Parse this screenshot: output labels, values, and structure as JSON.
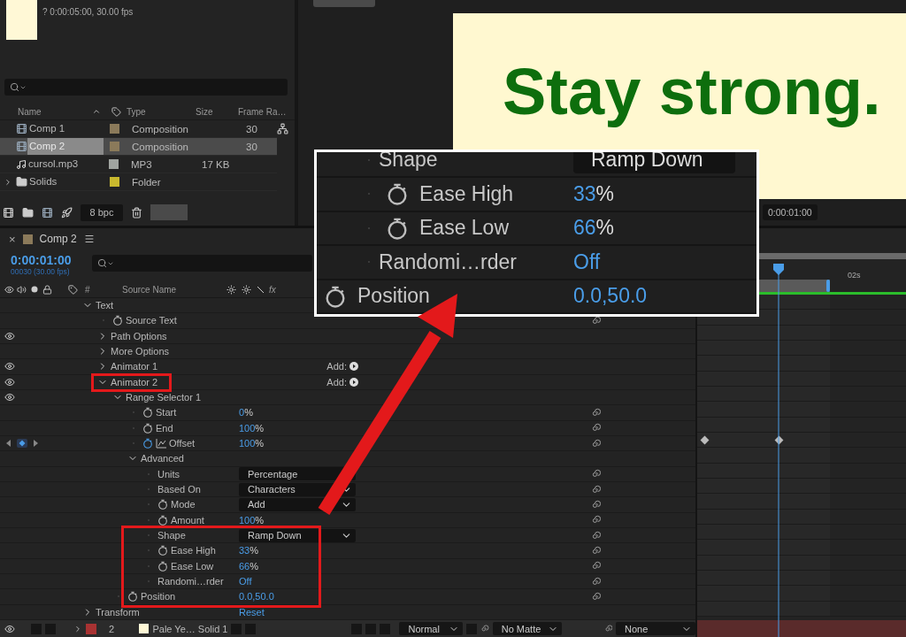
{
  "project": {
    "info": "? 0:00:05:00, 30.00 fps",
    "columns": {
      "name": "Name",
      "type": "Type",
      "size": "Size",
      "frame_rate": "Frame Ra…"
    },
    "items": [
      {
        "name": "Comp 1",
        "kind": "comp",
        "color": "#8b7a5a",
        "type": "Composition",
        "frame_rate": "30",
        "selected": false
      },
      {
        "name": "Comp 2",
        "kind": "comp",
        "color": "#8b7a5a",
        "type": "Composition",
        "frame_rate": "30",
        "selected": true
      },
      {
        "name": "cursol.mp3",
        "kind": "audio",
        "color": "#a0a4a0",
        "type": "MP3",
        "size": "17 KB",
        "selected": false
      },
      {
        "name": "Solids",
        "kind": "folder",
        "color": "#c9b92e",
        "type": "Folder",
        "expanded": false,
        "selected": false
      }
    ],
    "bit_depth": "8 bpc"
  },
  "viewer": {
    "caption": "Stay strong.",
    "timecode": "0:00:01:00"
  },
  "timeline": {
    "tab": {
      "close": "×",
      "title": "Comp 2",
      "color": "#8b7a5a"
    },
    "timecode": "0:00:01:00",
    "frame_info": "00030 (30.00 fps)",
    "columns": {
      "number": "#",
      "source_name": "Source Name",
      "fx": "fx"
    },
    "ruler_label": "02s",
    "properties": [
      {
        "label": "Text",
        "kind": "group",
        "expanded": true,
        "eye": false,
        "children": [
          {
            "label": "Source Text",
            "kind": "property",
            "stopwatch": true,
            "animated": false,
            "eye": false
          },
          {
            "label": "Path Options",
            "kind": "group",
            "expanded": false,
            "eye": true
          },
          {
            "label": "More Options",
            "kind": "group",
            "expanded": false,
            "eye": false
          },
          {
            "label": "Animator 1",
            "kind": "group",
            "expanded": false,
            "eye": true,
            "add": "Add:"
          },
          {
            "label": "Animator 2",
            "kind": "group",
            "expanded": true,
            "eye": true,
            "add": "Add:",
            "children": [
              {
                "label": "Range Selector 1",
                "kind": "group",
                "expanded": true,
                "eye": true,
                "children": [
                  {
                    "label": "Start",
                    "kind": "property",
                    "stopwatch": true,
                    "animated": false,
                    "eye": false,
                    "value": "0",
                    "unit": "%"
                  },
                  {
                    "label": "End",
                    "kind": "property",
                    "stopwatch": true,
                    "animated": false,
                    "eye": false,
                    "value": "100",
                    "unit": "%"
                  },
                  {
                    "label": "Offset",
                    "kind": "property",
                    "stopwatch": true,
                    "animated": true,
                    "eye": false,
                    "value": "100",
                    "unit": "%"
                  },
                  {
                    "label": "Advanced",
                    "kind": "group",
                    "expanded": true,
                    "eye": false,
                    "children": [
                      {
                        "label": "Units",
                        "kind": "dropdown",
                        "stopwatch": false,
                        "animated": false,
                        "eye": false,
                        "value": "Percentage",
                        "chevron": false
                      },
                      {
                        "label": "Based On",
                        "kind": "dropdown",
                        "stopwatch": false,
                        "animated": false,
                        "eye": false,
                        "value": "Characters",
                        "chevron": true
                      },
                      {
                        "label": "Mode",
                        "kind": "dropdown",
                        "stopwatch": true,
                        "animated": false,
                        "eye": false,
                        "value": "Add",
                        "chevron": true
                      },
                      {
                        "label": "Amount",
                        "kind": "property",
                        "stopwatch": true,
                        "animated": false,
                        "eye": false,
                        "value": "100",
                        "unit": "%"
                      },
                      {
                        "label": "Shape",
                        "kind": "dropdown",
                        "stopwatch": false,
                        "animated": false,
                        "eye": false,
                        "value": "Ramp Down",
                        "chevron": true
                      },
                      {
                        "label": "Ease High",
                        "kind": "property",
                        "stopwatch": true,
                        "animated": false,
                        "eye": false,
                        "value": "33",
                        "unit": "%"
                      },
                      {
                        "label": "Ease Low",
                        "kind": "property",
                        "stopwatch": true,
                        "animated": false,
                        "eye": false,
                        "value": "66",
                        "unit": "%"
                      },
                      {
                        "label": "Randomi…rder",
                        "kind": "property",
                        "stopwatch": false,
                        "animated": false,
                        "eye": false,
                        "value": "Off"
                      }
                    ]
                  }
                ]
              },
              {
                "label": "Position",
                "kind": "property",
                "stopwatch": true,
                "animated": false,
                "eye": false,
                "value": "0.0,50.0"
              }
            ]
          }
        ]
      },
      {
        "label": "Transform",
        "kind": "group",
        "expanded": false,
        "eye": false,
        "value": "Reset"
      }
    ],
    "layer": {
      "eye": true,
      "expanded": false,
      "color": "#a83232",
      "number": "2",
      "name": "Pale Ye… Solid 1",
      "mode": "Normal",
      "matte": "No Matte",
      "parent": "None"
    }
  },
  "callout": {
    "rows": [
      {
        "label": "Shape",
        "kind": "dropdown",
        "stopwatch": false,
        "value": "Ramp Down"
      },
      {
        "label": "Ease High",
        "kind": "property",
        "stopwatch": true,
        "value": "33",
        "unit": "%"
      },
      {
        "label": "Ease Low",
        "kind": "property",
        "stopwatch": true,
        "value": "66",
        "unit": "%"
      },
      {
        "label": "Randomi…rder",
        "kind": "property",
        "stopwatch": false,
        "value": "Off"
      },
      {
        "label": "Position",
        "kind": "outer",
        "stopwatch": true,
        "value": "0.0,50.0"
      }
    ]
  }
}
